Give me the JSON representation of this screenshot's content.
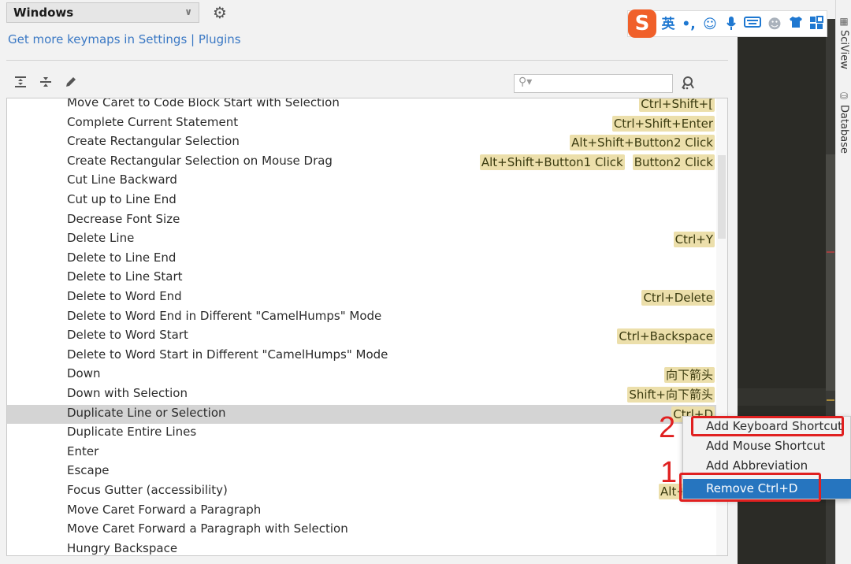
{
  "keymap": {
    "selected": "Windows",
    "link_text_prefix": "Get more keymaps in Settings",
    "link_separator": " | ",
    "link_plugins": "Plugins"
  },
  "toolbar": {
    "expand_all_icon": "expand-all-icon",
    "collapse_all_icon": "collapse-all-icon",
    "edit_icon": "pencil-icon",
    "search_placeholder": "",
    "search_value": "",
    "find_by_shortcut_icon": "find-by-shortcut-icon"
  },
  "actions": [
    {
      "name": "Move Caret to Code Block Start with Selection",
      "shortcuts": [
        "Ctrl+Shift+["
      ]
    },
    {
      "name": "Complete Current Statement",
      "shortcuts": [
        "Ctrl+Shift+Enter"
      ]
    },
    {
      "name": "Create Rectangular Selection",
      "shortcuts": [
        "Alt+Shift+Button2 Click"
      ]
    },
    {
      "name": "Create Rectangular Selection on Mouse Drag",
      "shortcuts": [
        "Alt+Shift+Button1 Click",
        "Button2 Click"
      ]
    },
    {
      "name": "Cut Line Backward",
      "shortcuts": []
    },
    {
      "name": "Cut up to Line End",
      "shortcuts": []
    },
    {
      "name": "Decrease Font Size",
      "shortcuts": []
    },
    {
      "name": "Delete Line",
      "shortcuts": [
        "Ctrl+Y"
      ]
    },
    {
      "name": "Delete to Line End",
      "shortcuts": []
    },
    {
      "name": "Delete to Line Start",
      "shortcuts": []
    },
    {
      "name": "Delete to Word End",
      "shortcuts": [
        "Ctrl+Delete"
      ]
    },
    {
      "name": "Delete to Word End in Different \"CamelHumps\" Mode",
      "shortcuts": []
    },
    {
      "name": "Delete to Word Start",
      "shortcuts": [
        "Ctrl+Backspace"
      ]
    },
    {
      "name": "Delete to Word Start in Different \"CamelHumps\" Mode",
      "shortcuts": []
    },
    {
      "name": "Down",
      "shortcuts": [
        "向下箭头"
      ]
    },
    {
      "name": "Down with Selection",
      "shortcuts": [
        "Shift+向下箭头"
      ]
    },
    {
      "name": "Duplicate Line or Selection",
      "shortcuts": [
        "Ctrl+D"
      ],
      "selected": true
    },
    {
      "name": "Duplicate Entire Lines",
      "shortcuts": []
    },
    {
      "name": "Enter",
      "shortcuts": []
    },
    {
      "name": "Escape",
      "shortcuts": []
    },
    {
      "name": "Focus Gutter (accessibility)",
      "shortcuts": [
        "Alt+Shift"
      ]
    },
    {
      "name": "Move Caret Forward a Paragraph",
      "shortcuts": []
    },
    {
      "name": "Move Caret Forward a Paragraph with Selection",
      "shortcuts": []
    },
    {
      "name": "Hungry Backspace",
      "shortcuts": []
    }
  ],
  "context_menu": {
    "items": [
      {
        "label": "Add Keyboard Shortcut"
      },
      {
        "label": "Add Mouse Shortcut"
      },
      {
        "label": "Add Abbreviation"
      },
      {
        "label": "Remove Ctrl+D",
        "active": true
      }
    ]
  },
  "annotations": {
    "num1": "1",
    "num2": "2",
    "color": "#e02020"
  },
  "ime_toolbar": {
    "logo": "S",
    "lang": "英",
    "punct": "•,",
    "items": [
      "emoji-icon",
      "microphone-icon",
      "keyboard-icon",
      "user-icon",
      "skin-icon",
      "toolbox-icon"
    ]
  },
  "tool_windows": [
    {
      "label": "SciView",
      "icon": "grid-icon"
    },
    {
      "label": "Database",
      "icon": "database-icon"
    }
  ],
  "colors": {
    "shortcut_badge": "#ecdfab",
    "link": "#3a78c4",
    "menu_active": "#2675bf",
    "selected_row": "#d4d4d4",
    "editor_bg": "#2b2b26",
    "ime_blue": "#1f78d1",
    "ime_logo": "#f0602a"
  }
}
